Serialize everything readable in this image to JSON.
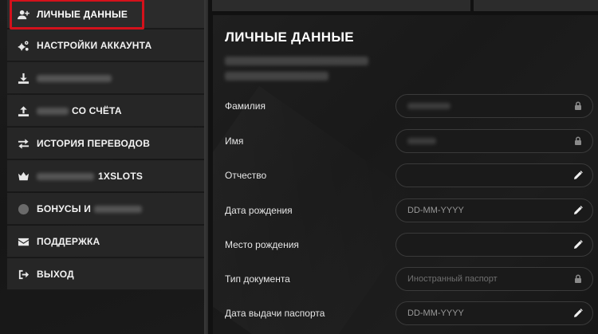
{
  "sidebar": {
    "items": [
      {
        "label": "ЛИЧНЫЕ ДАННЫЕ",
        "icon": "user-plus-icon",
        "active": true
      },
      {
        "label": "НАСТРОЙКИ АККАУНТА",
        "icon": "gears-icon"
      },
      {
        "label": "",
        "icon": "download-icon"
      },
      {
        "label": "СО СЧЁТА",
        "icon": "upload-icon"
      },
      {
        "label": "ИСТОРИЯ ПЕРЕВОДОВ",
        "icon": "transfer-arrows-icon"
      },
      {
        "label": "1XSLOTS",
        "icon": "crown-icon"
      },
      {
        "label": "БОНУСЫ И",
        "icon": "gift-icon"
      },
      {
        "label": "ПОДДЕРЖКА",
        "icon": "envelope-icon"
      },
      {
        "label": "ВЫХОД",
        "icon": "sign-out-icon"
      }
    ]
  },
  "panel": {
    "title": "ЛИЧНЫЕ ДАННЫЕ"
  },
  "form": {
    "fields": [
      {
        "label": "Фамилия",
        "value": "",
        "placeholder": "",
        "locked": true
      },
      {
        "label": "Имя",
        "value": "",
        "placeholder": "",
        "locked": true
      },
      {
        "label": "Отчество",
        "value": "",
        "placeholder": "",
        "locked": false
      },
      {
        "label": "Дата рождения",
        "value": "",
        "placeholder": "DD-MM-YYYY",
        "locked": false
      },
      {
        "label": "Место рождения",
        "value": "",
        "placeholder": "",
        "locked": false
      },
      {
        "label": "Тип документа",
        "value": "",
        "placeholder": "Иностранный паспорт",
        "locked": true
      },
      {
        "label": "Дата выдачи паспорта",
        "value": "",
        "placeholder": "DD-MM-YYYY",
        "locked": false
      }
    ]
  },
  "colors": {
    "accent_outline": "#d4111b",
    "sidebar_item_bg": "#262626",
    "panel_bg": "#1f1f1f",
    "field_border": "#3a3a3a"
  }
}
